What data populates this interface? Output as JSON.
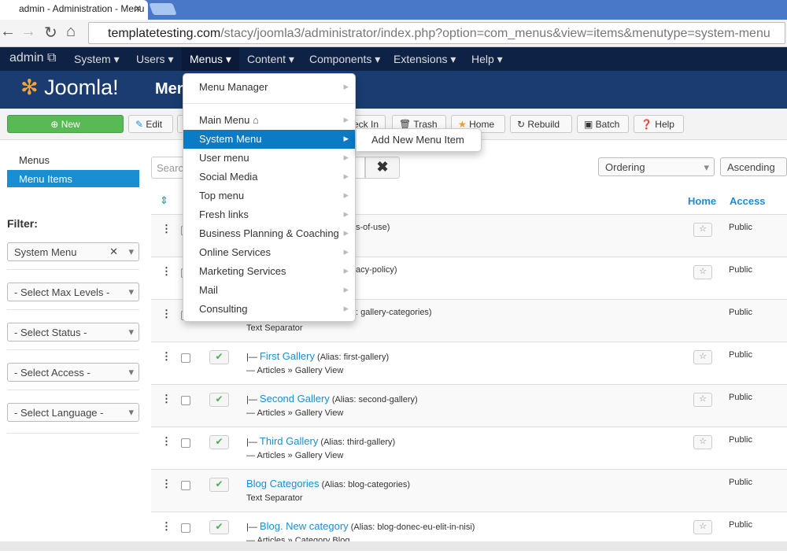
{
  "browser": {
    "tab_title": "admin - Administration - Menu",
    "url_host": "templatetesting.com",
    "url_path": "/stacy/joomla3/administrator/index.php?option=com_menus&view=items&menutype=system-menu"
  },
  "nav": {
    "brand": "admin",
    "items": [
      "System",
      "Users",
      "Menus",
      "Content",
      "Components",
      "Extensions",
      "Help"
    ],
    "active": "Menus"
  },
  "header": {
    "logo": "Joomla!",
    "title": "Menu"
  },
  "toolbar": {
    "new": "New",
    "edit": "Edit",
    "checkin": "eck In",
    "trash": "Trash",
    "home": "Home",
    "rebuild": "Rebuild",
    "batch": "Batch",
    "help": "Help"
  },
  "sidebar": {
    "items": [
      "Menus",
      "Menu Items"
    ],
    "filter_label": "Filter:",
    "filters": [
      "System Menu",
      "- Select Max Levels -",
      "- Select Status -",
      "- Select Access -",
      "- Select Language -"
    ]
  },
  "search": {
    "placeholder": "Search"
  },
  "sort": {
    "ordering": "Ordering",
    "direction": "Ascending"
  },
  "table": {
    "headers": {
      "home": "Home",
      "access": "Access"
    },
    "rows": [
      {
        "title": "",
        "alias": "s-of-use)",
        "type": "",
        "home": true,
        "access": "Public"
      },
      {
        "title": "",
        "alias": "acy-policy)",
        "type": "",
        "home": true,
        "access": "Public"
      },
      {
        "title": "",
        "alias": ": gallery-categories)",
        "type": "Text Separator",
        "home": false,
        "access": "Public"
      },
      {
        "prefix": "|— ",
        "title": "First Gallery",
        "alias": "(Alias: first-gallery)",
        "type": "— Articles » Gallery View",
        "home": true,
        "access": "Public"
      },
      {
        "prefix": "|— ",
        "title": "Second Gallery",
        "alias": "(Alias: second-gallery)",
        "type": "— Articles » Gallery View",
        "home": true,
        "access": "Public"
      },
      {
        "prefix": "|— ",
        "title": "Third Gallery",
        "alias": "(Alias: third-gallery)",
        "type": "— Articles » Gallery View",
        "home": true,
        "access": "Public"
      },
      {
        "prefix": "",
        "title": "Blog Categories",
        "alias": "(Alias: blog-categories)",
        "type": "Text Separator",
        "home": false,
        "access": "Public"
      },
      {
        "prefix": "|— ",
        "title": "Blog. New category",
        "alias": "(Alias: blog-donec-eu-elit-in-nisi)",
        "type": "— Articles » Category Blog",
        "home": true,
        "access": "Public"
      }
    ]
  },
  "dropdown": {
    "manager": "Menu Manager",
    "items": [
      "Main Menu",
      "System Menu",
      "User menu",
      "Social Media",
      "Top menu",
      "Fresh links",
      "Business Planning & Coaching",
      "Online Services",
      "Marketing Services",
      "Mail",
      "Consulting"
    ],
    "active": "System Menu",
    "submenu": "Add New Menu Item"
  }
}
